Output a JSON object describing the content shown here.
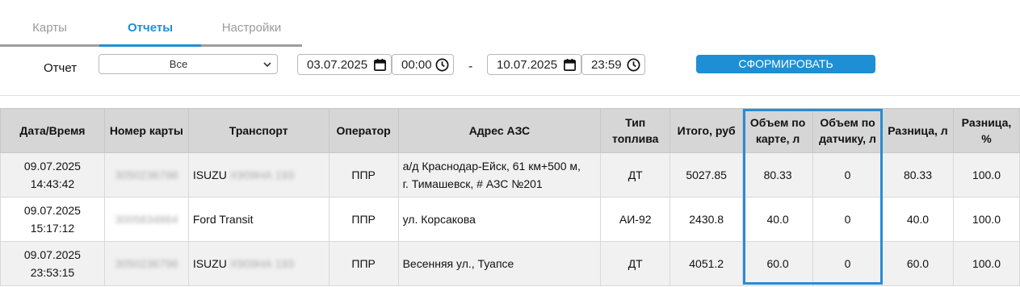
{
  "tabs": [
    {
      "label": "Карты"
    },
    {
      "label": "Отчеты"
    },
    {
      "label": "Настройки"
    }
  ],
  "filter": {
    "report_label": "Отчет",
    "report_select": "Все",
    "date_from": "03.07.2025",
    "time_from": "00:00",
    "separator": "-",
    "date_to": "10.07.2025",
    "time_to": "23:59",
    "generate_button": "СФОРМИРОВАТЬ"
  },
  "table": {
    "headers": {
      "datetime": "Дата/Время",
      "card": "Номер карты",
      "transport": "Транспорт",
      "operator": "Оператор",
      "address": "Адрес АЗС",
      "fuel": "Тип топлива",
      "total": "Итого, руб",
      "vol_card": "Объем по карте, л",
      "vol_sensor": "Объем по датчику, л",
      "diff_l": "Разница, л",
      "diff_pct": "Разница, %"
    },
    "rows": [
      {
        "date": "09.07.2025",
        "time": "14:43:42",
        "card": "3050236798",
        "transport": "ISUZU",
        "plate": "Х909НА 193",
        "operator": "ППР",
        "address_1": "а/д Краснодар-Ейск, 61 км+500 м,",
        "address_2": "г. Тимашевск, # АЗС №201",
        "fuel": "ДТ",
        "total": "5027.85",
        "vol_card": "80.33",
        "vol_sensor": "0",
        "diff_l": "80.33",
        "diff_pct": "100.0"
      },
      {
        "date": "09.07.2025",
        "time": "15:17:12",
        "card": "3005834864",
        "transport": "Ford Transit",
        "plate": "",
        "operator": "ППР",
        "address_1": "ул. Корсакова",
        "address_2": "",
        "fuel": "АИ-92",
        "total": "2430.8",
        "vol_card": "40.0",
        "vol_sensor": "0",
        "diff_l": "40.0",
        "diff_pct": "100.0"
      },
      {
        "date": "09.07.2025",
        "time": "23:53:15",
        "card": "3050236798",
        "transport": "ISUZU",
        "plate": "Х909НА 193",
        "operator": "ППР",
        "address_1": "Весенняя ул., Туапсе",
        "address_2": "",
        "fuel": "ДТ",
        "total": "4051.2",
        "vol_card": "60.0",
        "vol_sensor": "0",
        "diff_l": "60.0",
        "diff_pct": "100.0"
      }
    ]
  },
  "colors": {
    "accent": "#1e8fd4",
    "highlight": "#2a8bd6",
    "header_bg": "#d6d6d6"
  }
}
